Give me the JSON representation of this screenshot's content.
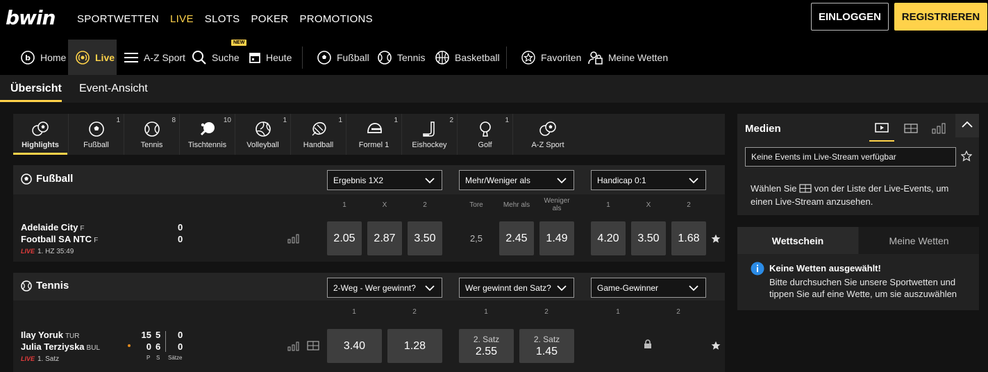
{
  "brand": {
    "logo": "bwin"
  },
  "top_nav": [
    "SPORTWETTEN",
    "LIVE",
    "SLOTS",
    "POKER",
    "PROMOTIONS"
  ],
  "auth": {
    "login": "EINLOGGEN",
    "register": "REGISTRIEREN"
  },
  "sec_nav": {
    "home": "Home",
    "live": "Live",
    "az": "A-Z Sport",
    "search": "Suche",
    "search_badge": "NEW",
    "today": "Heute",
    "football": "Fußball",
    "tennis": "Tennis",
    "basketball": "Basketball",
    "favourites": "Favoriten",
    "mybets": "Meine Wetten"
  },
  "view_tabs": {
    "overview": "Übersicht",
    "event": "Event-Ansicht"
  },
  "sports": [
    {
      "label": "Highlights",
      "count": "",
      "icon": "highlights-icon"
    },
    {
      "label": "Fußball",
      "count": "1",
      "icon": "football-icon"
    },
    {
      "label": "Tennis",
      "count": "8",
      "icon": "tennis-icon"
    },
    {
      "label": "Tischtennis",
      "count": "10",
      "icon": "table-tennis-icon"
    },
    {
      "label": "Volleyball",
      "count": "1",
      "icon": "volleyball-icon"
    },
    {
      "label": "Handball",
      "count": "1",
      "icon": "handball-icon"
    },
    {
      "label": "Formel 1",
      "count": "1",
      "icon": "formula1-icon"
    },
    {
      "label": "Eishockey",
      "count": "2",
      "icon": "ice-hockey-icon"
    },
    {
      "label": "Golf",
      "count": "1",
      "icon": "golf-icon"
    },
    {
      "label": "A-Z Sport",
      "count": "",
      "icon": "az-sport-icon"
    }
  ],
  "football": {
    "title": "Fußball",
    "markets": [
      "Ergebnis 1X2",
      "Mehr/Weniger als",
      "Handicap 0:1"
    ],
    "col_heads": {
      "h1": "1",
      "hx": "X",
      "h2": "2",
      "tore": "Tore",
      "mehr": "Mehr als",
      "weniger": "Weniger als",
      "hc1": "1",
      "hcx": "X",
      "hc2": "2"
    },
    "match": {
      "team1": "Adelaide City",
      "team1_suffix": "F",
      "team2": "Football SA NTC",
      "team2_suffix": "F",
      "score1": "0",
      "score2": "0",
      "live": "LIVE",
      "time": "1. HZ 35:49",
      "odds_1x2": [
        "2.05",
        "2.87",
        "3.50"
      ],
      "line": "2,5",
      "odds_ou": [
        "2.45",
        "1.49"
      ],
      "odds_hc": [
        "4.20",
        "3.50",
        "1.68"
      ]
    }
  },
  "tennis": {
    "title": "Tennis",
    "markets": [
      "2-Weg - Wer gewinnt?",
      "Wer gewinnt den Satz?",
      "Game-Gewinner"
    ],
    "col_heads": {
      "a1": "1",
      "a2": "2",
      "b1": "1",
      "b2": "2",
      "c1": "1",
      "c2": "2"
    },
    "match": {
      "team1": "Ilay Yoruk",
      "team1_suffix": "TUR",
      "team2": "Julia Terziyska",
      "team2_suffix": "BUL",
      "p1": "15",
      "s1": "5",
      "sets1": "0",
      "p2": "0",
      "s2": "6",
      "sets2": "0",
      "col_p": "P",
      "col_s": "S",
      "col_sets": "Sätze",
      "live": "LIVE",
      "time": "1. Satz",
      "odds_win": [
        "3.40",
        "1.28"
      ],
      "set_label": "2. Satz",
      "odds_set": [
        "2.55",
        "1.45"
      ]
    }
  },
  "media": {
    "title": "Medien",
    "input": "Keine Events im Live-Stream verfügbar",
    "hint_pre": "Wählen Sie",
    "hint_post": "von der Liste der Live-Events, um einen Live-Stream anzusehen."
  },
  "betslip": {
    "tab_active": "Wettschein",
    "tab_other": "Meine Wetten",
    "title": "Keine Wetten ausgewählt!",
    "text": "Bitte durchsuchen Sie unsere Sportwetten und tippen Sie auf eine Wette, um sie auszuwählen"
  },
  "colors": {
    "accent": "#ffd24a",
    "live": "#e23b3b",
    "info": "#2b8be6"
  }
}
